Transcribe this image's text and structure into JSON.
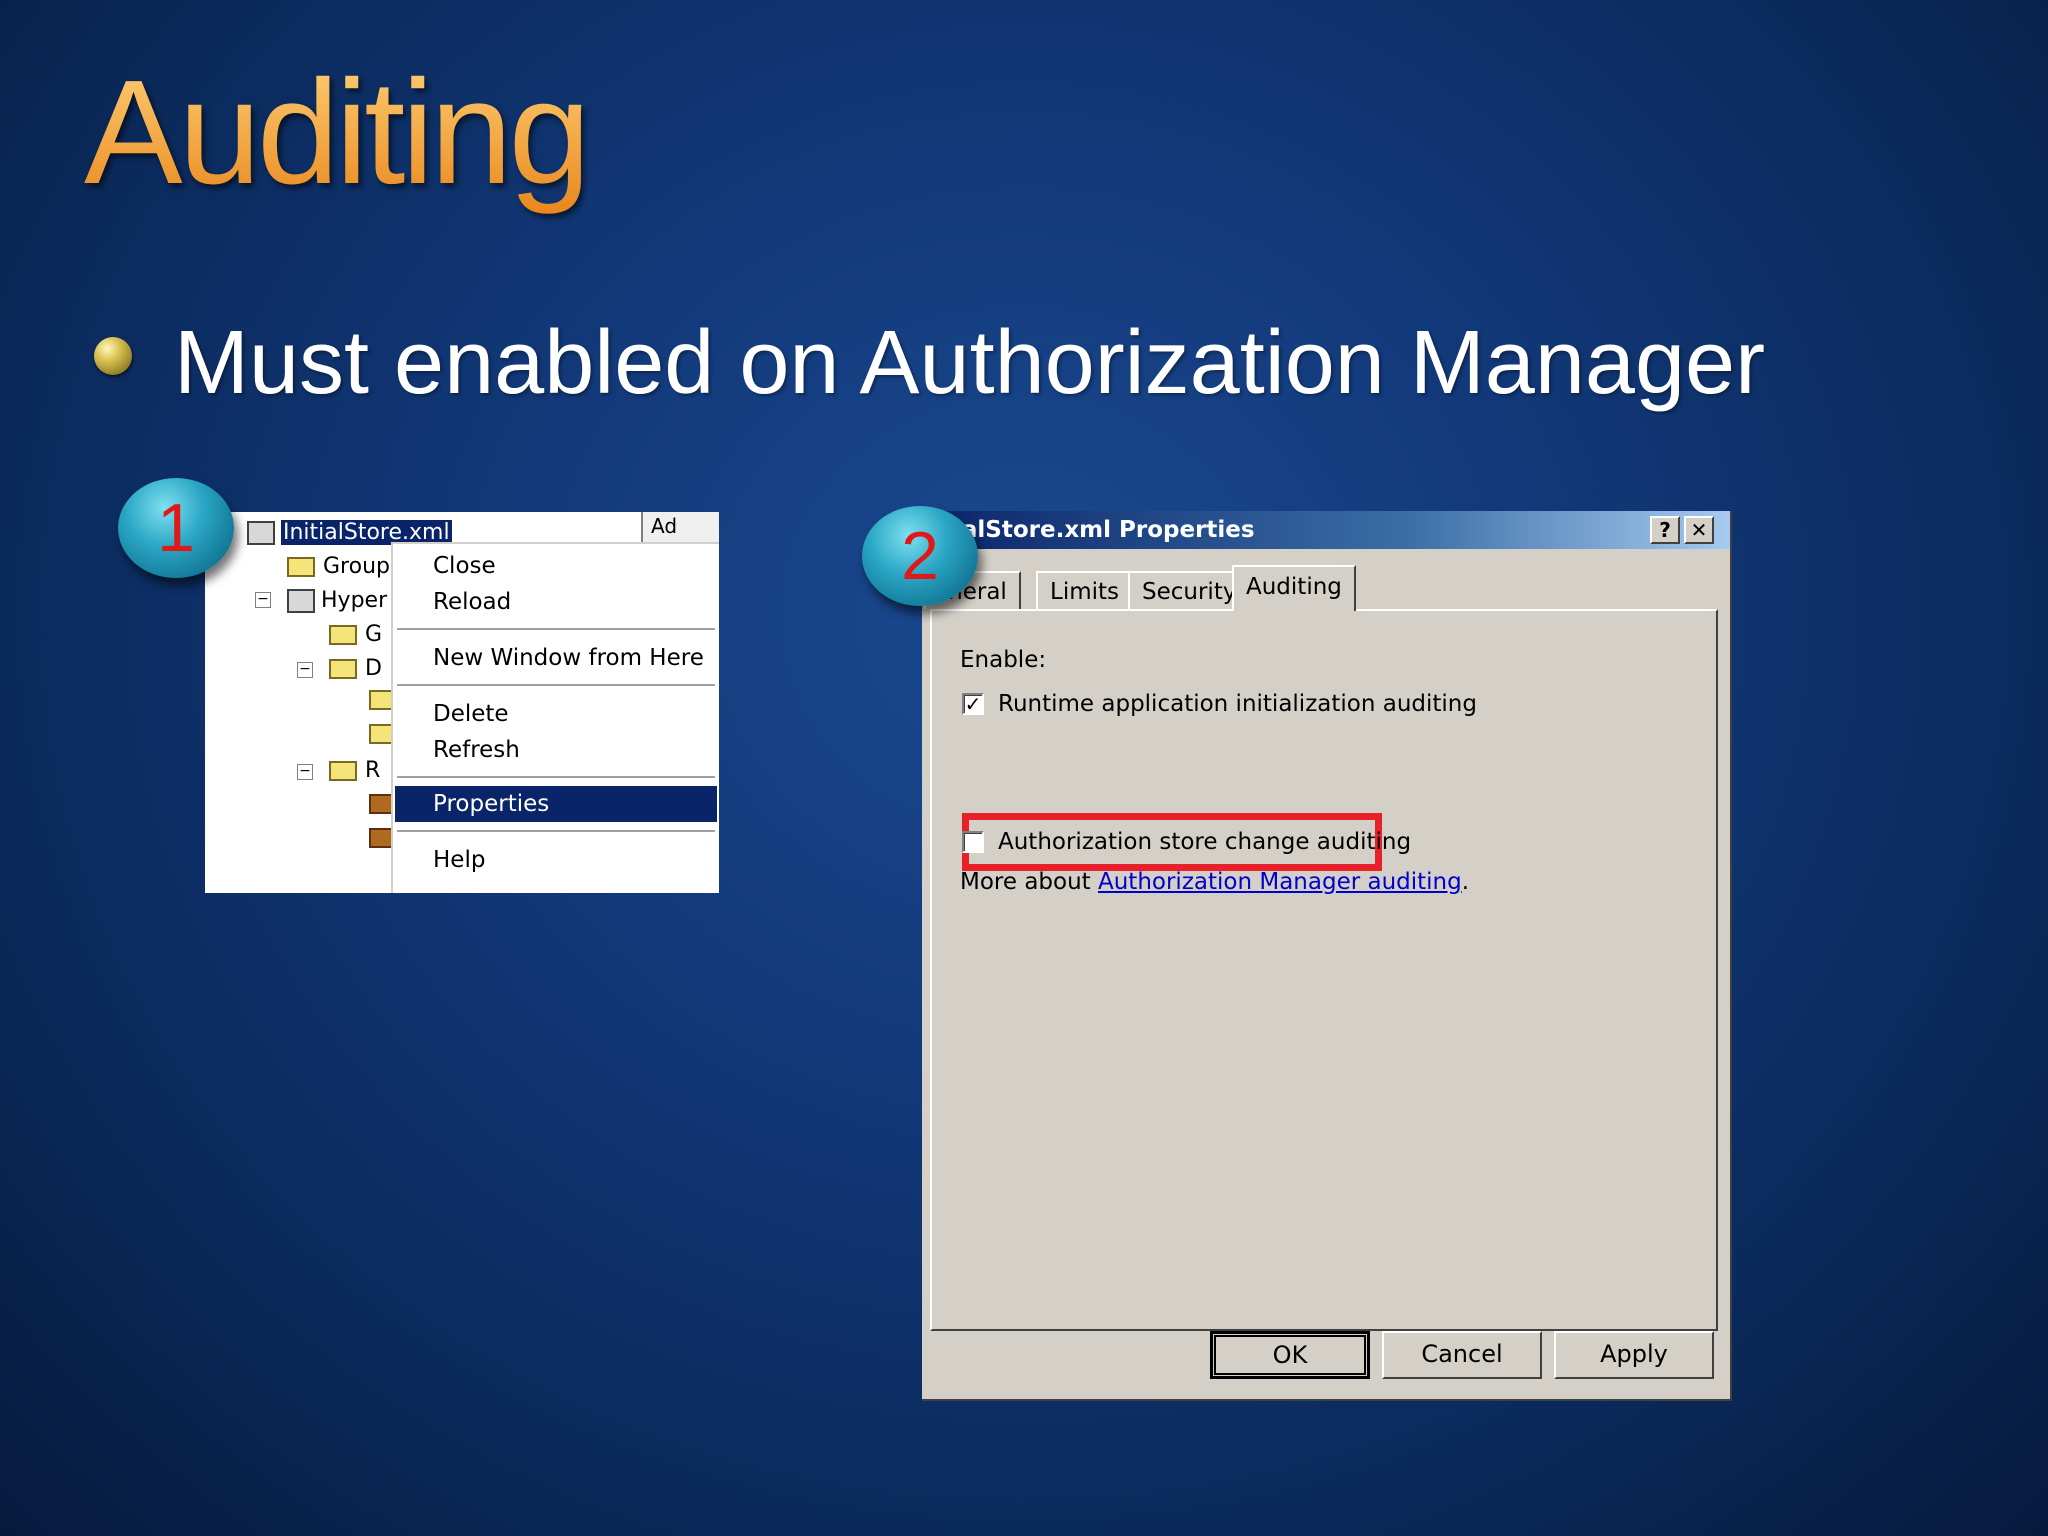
{
  "slide": {
    "title": "Auditing",
    "bullet": "Must enabled on Authorization Manager"
  },
  "steps": [
    "1",
    "2"
  ],
  "shot1": {
    "tree": {
      "root_label": "InitialStore.xml",
      "items": [
        "Group",
        "Hyper",
        "G",
        "D",
        "R"
      ],
      "right_strip_text": "Ad"
    },
    "context_menu": {
      "items": [
        "Close",
        "Reload",
        "New Window from Here",
        "Delete",
        "Refresh",
        "Properties",
        "Help"
      ],
      "selected": "Properties"
    }
  },
  "shot2": {
    "title": "ialStore.xml Properties",
    "titlebar_buttons": {
      "help": "?",
      "close": "✕"
    },
    "tabs": [
      "eneral",
      "Limits",
      "Security",
      "Auditing"
    ],
    "active_tab": "Auditing",
    "enable_label": "Enable:",
    "options": [
      {
        "label": "Runtime application initialization auditing",
        "checked": true
      },
      {
        "label": "Authorization store change auditing",
        "checked": false
      }
    ],
    "more_about_prefix": "More about ",
    "more_about_link": "Authorization Manager auditing",
    "more_about_suffix": ".",
    "buttons": {
      "ok": "OK",
      "cancel": "Cancel",
      "apply": "Apply"
    }
  },
  "colors": {
    "title_gradient": [
      "#ffd27a",
      "#e8851a"
    ],
    "highlight": "#e8202a",
    "selection": "#0a246a"
  }
}
